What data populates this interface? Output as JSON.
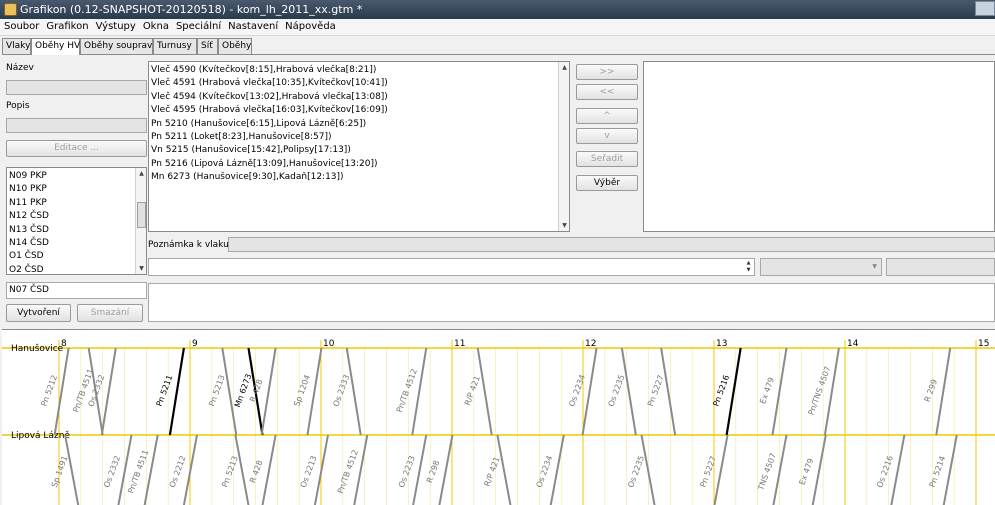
{
  "window": {
    "title": "Grafikon (0.12-SNAPSHOT-20120518) - kom_lh_2011_xx.gtm *"
  },
  "menu": [
    "Soubor",
    "Grafikon",
    "Výstupy",
    "Okna",
    "Speciální",
    "Nastavení",
    "Nápověda"
  ],
  "tabs": [
    "Vlaky",
    "Oběhy HV",
    "Oběhy souprav",
    "Turnusy",
    "Síť",
    "Oběhy"
  ],
  "active_tab": "Oběhy HV",
  "left": {
    "name_label": "Název",
    "desc_label": "Popis",
    "edit_button": "Editace ...",
    "circulations": [
      "N09 PKP",
      "N10 PKP",
      "N11 PKP",
      "N12 ČSD",
      "N13 ČSD",
      "N14 ČSD",
      "O1 ČSD",
      "O2 ČSD"
    ],
    "new_name_value": "N07 ČSD",
    "create_button": "Vytvoření",
    "delete_button": "Smazání"
  },
  "trains": [
    "Vleč 4590 (Kvítečkov[8:15],Hrabová vlečka[8:21])",
    "Vleč 4591 (Hrabová vlečka[10:35],Kvítečkov[10:41])",
    "Vleč 4594 (Kvítečkov[13:02],Hrabová vlečka[13:08])",
    "Vleč 4595 (Hrabová vlečka[16:03],Kvítečkov[16:09])",
    "Pn 5210 (Hanušovice[6:15],Lipová Lázně[6:25])",
    "Pn 5211 (Loket[8:23],Hanušovice[8:57])",
    "Vn 5215 (Hanušovice[15:42],Polipsy[17:13])",
    "Pn 5216 (Lipová Lázně[13:09],Hanušovice[13:20])",
    "Mn 6273 (Hanušovice[9:30],Kadaň[12:13])"
  ],
  "controls": {
    "add_button": ">>",
    "remove_button": "<<",
    "up_button": "^",
    "down_button": "v",
    "sort_button": "Seřadit",
    "select_button": "Výběr",
    "note_label": "Poznámka k vlaku:"
  },
  "graph": {
    "hours": [
      "8",
      "9",
      "10",
      "11",
      "12",
      "13",
      "14",
      "15"
    ],
    "stations": [
      "Hanušovice",
      "Lipová Lázně"
    ],
    "colors": {
      "station_line": "#f0c800",
      "grid": "#f7e890",
      "train_gray": "#8a8a8a",
      "train_selected": "#000000"
    },
    "trains_upper": [
      {
        "label": "Pn 5212",
        "t": 8.02,
        "dir": -1,
        "sel": false
      },
      {
        "label": "Pn/TB 4511",
        "t": 8.28,
        "dir": 1,
        "sel": false
      },
      {
        "label": "Os 2332",
        "t": 8.38,
        "dir": -1,
        "sel": false
      },
      {
        "label": "Pn 5211",
        "t": 8.9,
        "dir": -1,
        "sel": true
      },
      {
        "label": "Pn 5213",
        "t": 9.3,
        "dir": 1,
        "sel": false
      },
      {
        "label": "Mn 6273",
        "t": 9.5,
        "dir": 1,
        "sel": true
      },
      {
        "label": "R 428",
        "t": 9.6,
        "dir": -1,
        "sel": false
      },
      {
        "label": "Sp 1204",
        "t": 9.95,
        "dir": -1,
        "sel": false
      },
      {
        "label": "Os 2333",
        "t": 10.25,
        "dir": 1,
        "sel": false
      },
      {
        "label": "Pn/TB 4512",
        "t": 10.75,
        "dir": -1,
        "sel": false
      },
      {
        "label": "R/P 421",
        "t": 11.25,
        "dir": 1,
        "sel": false
      },
      {
        "label": "Os 2234",
        "t": 12.05,
        "dir": -1,
        "sel": false
      },
      {
        "label": "Os 2235",
        "t": 12.35,
        "dir": 1,
        "sel": false
      },
      {
        "label": "Pn 5227",
        "t": 12.65,
        "dir": 1,
        "sel": false
      },
      {
        "label": "Pn 5216",
        "t": 13.15,
        "dir": -1,
        "sel": true
      },
      {
        "label": "Ex 479",
        "t": 13.5,
        "dir": -1,
        "sel": false
      },
      {
        "label": "Pn/TNS 4507",
        "t": 13.9,
        "dir": -1,
        "sel": false
      },
      {
        "label": "R 299",
        "t": 14.75,
        "dir": -1,
        "sel": false
      }
    ],
    "trains_lower": [
      {
        "label": "Sp 1491",
        "t": 8.1,
        "dir": 1,
        "sel": false
      },
      {
        "label": "Os 2332",
        "t": 8.5,
        "dir": -1,
        "sel": false
      },
      {
        "label": "Pn/TB 4511",
        "t": 8.7,
        "dir": -1,
        "sel": false
      },
      {
        "label": "Os 2212",
        "t": 9.0,
        "dir": -1,
        "sel": false
      },
      {
        "label": "Pn 5213",
        "t": 9.4,
        "dir": 1,
        "sel": false
      },
      {
        "label": "R 428",
        "t": 9.6,
        "dir": -1,
        "sel": false
      },
      {
        "label": "Os 2213",
        "t": 10.0,
        "dir": -1,
        "sel": false
      },
      {
        "label": "Pn/TB 4512",
        "t": 10.3,
        "dir": -1,
        "sel": false
      },
      {
        "label": "Os 2233",
        "t": 10.75,
        "dir": -1,
        "sel": false
      },
      {
        "label": "R 298",
        "t": 10.95,
        "dir": -1,
        "sel": false
      },
      {
        "label": "R/P 421",
        "t": 11.4,
        "dir": 1,
        "sel": false
      },
      {
        "label": "Os 2234",
        "t": 11.8,
        "dir": -1,
        "sel": false
      },
      {
        "label": "Os 2235",
        "t": 12.5,
        "dir": 1,
        "sel": false
      },
      {
        "label": "Pn 5227",
        "t": 13.05,
        "dir": -1,
        "sel": false
      },
      {
        "label": "TNS 4507",
        "t": 13.5,
        "dir": -1,
        "sel": false
      },
      {
        "label": "Ex 479",
        "t": 13.8,
        "dir": -1,
        "sel": false
      },
      {
        "label": "Os 2216",
        "t": 14.4,
        "dir": -1,
        "sel": false
      },
      {
        "label": "Pn 5214",
        "t": 14.8,
        "dir": -1,
        "sel": false
      }
    ]
  }
}
